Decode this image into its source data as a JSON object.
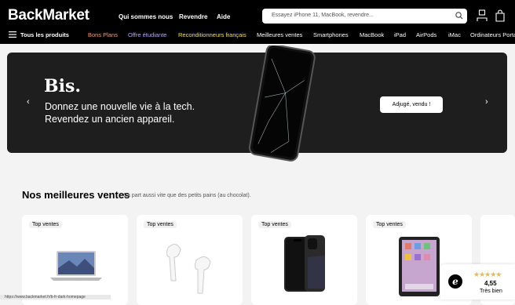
{
  "header": {
    "logo": "BackMarket",
    "nav": [
      "Qui sommes nous",
      "Revendre",
      "Aide"
    ],
    "search_placeholder": "Essayez iPhone 11, MacBook, revendre..."
  },
  "categories": [
    {
      "label": "Tous les produits",
      "color": "#ffffff"
    },
    {
      "label": "Bons Plans",
      "color": "#f2a37a"
    },
    {
      "label": "Offre étudiante",
      "color": "#b6a7ff"
    },
    {
      "label": "Reconditionneurs français",
      "color": "#f7e14b"
    },
    {
      "label": "Meilleures ventes",
      "color": "#ffffff"
    },
    {
      "label": "Smartphones",
      "color": "#ffffff"
    },
    {
      "label": "MacBook",
      "color": "#ffffff"
    },
    {
      "label": "iPad",
      "color": "#ffffff"
    },
    {
      "label": "AirPods",
      "color": "#ffffff"
    },
    {
      "label": "iMac",
      "color": "#ffffff"
    },
    {
      "label": "Ordinateurs Portables",
      "color": "#ffffff"
    }
  ],
  "hero": {
    "title": "Bis.",
    "line1": "Donnez une nouvelle vie à la tech.",
    "line2": "Revendez un ancien appareil.",
    "button": "Adjugé, vendu !"
  },
  "section": {
    "title": "Nos meilleures ventes",
    "subtitle": "Ça part aussi vite que des petits pains (au chocolat)."
  },
  "cards": [
    {
      "badge": "Top ventes",
      "product": "macbook"
    },
    {
      "badge": "Top ventes",
      "product": "airpods"
    },
    {
      "badge": "Top ventes",
      "product": "iphone"
    },
    {
      "badge": "Top ventes",
      "product": "ipad"
    }
  ],
  "rating": {
    "logo": "e",
    "stars": "★★★★★",
    "score": "4,55",
    "label": "Très bien"
  },
  "status_url": "https://www.backmarket.fr/b-fr-dark-homepage"
}
